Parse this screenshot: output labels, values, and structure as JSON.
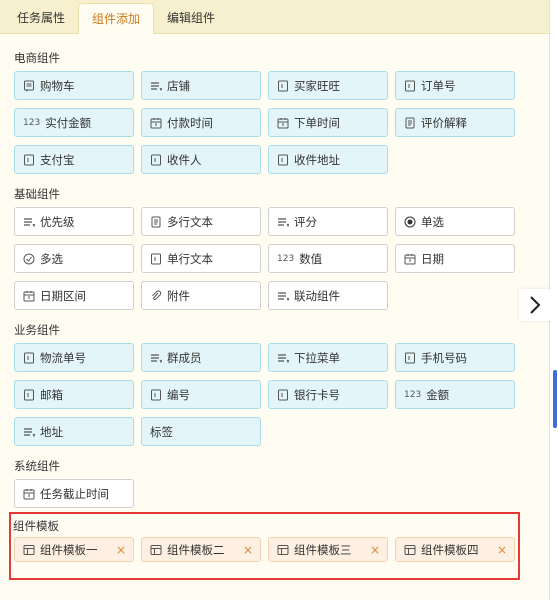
{
  "tabs": [
    {
      "label": "任务属性"
    },
    {
      "label": "组件添加",
      "active": true
    },
    {
      "label": "编辑组件"
    }
  ],
  "sections": {
    "ecommerce": {
      "title": "电商组件",
      "items": [
        {
          "label": "购物车",
          "icon": "cart-note-icon"
        },
        {
          "label": "店铺",
          "icon": "list-icon"
        },
        {
          "label": "买家旺旺",
          "icon": "field-icon"
        },
        {
          "label": "订单号",
          "icon": "field-icon"
        },
        {
          "label": "实付金额",
          "icon": "number-icon",
          "prefix": "123"
        },
        {
          "label": "付款时间",
          "icon": "calendar-icon"
        },
        {
          "label": "下单时间",
          "icon": "calendar-icon"
        },
        {
          "label": "评价解释",
          "icon": "document-icon"
        },
        {
          "label": "支付宝",
          "icon": "field-icon"
        },
        {
          "label": "收件人",
          "icon": "field-icon"
        },
        {
          "label": "收件地址",
          "icon": "field-icon"
        }
      ]
    },
    "basic": {
      "title": "基础组件",
      "items": [
        {
          "label": "优先级",
          "icon": "list-icon"
        },
        {
          "label": "多行文本",
          "icon": "document-icon"
        },
        {
          "label": "评分",
          "icon": "list-icon"
        },
        {
          "label": "单选",
          "icon": "radio-icon"
        },
        {
          "label": "多选",
          "icon": "checkbox-icon"
        },
        {
          "label": "单行文本",
          "icon": "field-icon"
        },
        {
          "label": "数值",
          "icon": "number-icon",
          "prefix": "123"
        },
        {
          "label": "日期",
          "icon": "calendar-icon"
        },
        {
          "label": "日期区间",
          "icon": "calendar-icon"
        },
        {
          "label": "附件",
          "icon": "paperclip-icon"
        },
        {
          "label": "联动组件",
          "icon": "list-icon"
        }
      ]
    },
    "business": {
      "title": "业务组件",
      "items": [
        {
          "label": "物流单号",
          "icon": "field-icon"
        },
        {
          "label": "群成员",
          "icon": "list-icon"
        },
        {
          "label": "下拉菜单",
          "icon": "list-icon"
        },
        {
          "label": "手机号码",
          "icon": "field-icon"
        },
        {
          "label": "邮箱",
          "icon": "field-icon"
        },
        {
          "label": "编号",
          "icon": "field-icon"
        },
        {
          "label": "银行卡号",
          "icon": "field-icon"
        },
        {
          "label": "金额",
          "icon": "number-icon",
          "prefix": "123"
        },
        {
          "label": "地址",
          "icon": "list-icon"
        },
        {
          "label": "标签",
          "icon": "none"
        }
      ]
    },
    "system": {
      "title": "系统组件",
      "items": [
        {
          "label": "任务截止时间",
          "icon": "calendar-icon"
        }
      ]
    },
    "templates": {
      "title": "组件模板",
      "items": [
        {
          "label": "组件模板一",
          "close": "×"
        },
        {
          "label": "组件模板二",
          "close": "×"
        },
        {
          "label": "组件模板三",
          "close": "×"
        },
        {
          "label": "组件模板四",
          "close": "×"
        }
      ]
    }
  },
  "colors": {
    "tab_active": "#c97a1c",
    "ecommerce_bg": "#e4f5f9",
    "ecommerce_border": "#a9dce6",
    "template_bg": "#fdf0e2",
    "highlight": "#e53935",
    "scroll_thumb": "#3b6fd6"
  }
}
